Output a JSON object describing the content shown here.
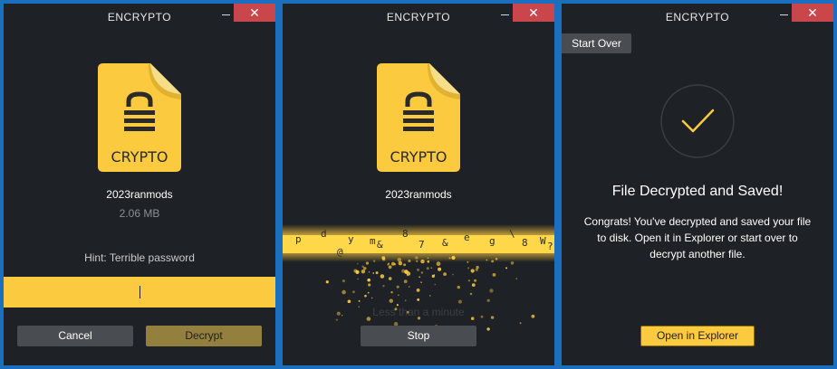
{
  "app": {
    "title": "ENCRYPTO",
    "close_glyph": "✕",
    "minimize_icon": "minimize-icon",
    "close_icon": "close-icon"
  },
  "colors": {
    "accent": "#fcca3f",
    "window_bg": "#1e2125",
    "button_gray": "#494c50",
    "close_red": "#c9464b"
  },
  "file_icon": {
    "label": "CRYPTO",
    "icon": "crypto-file-lock-icon"
  },
  "decrypt_window": {
    "file_name": "2023ranmods",
    "file_size": "2.06 MB",
    "hint": "Hint: Terrible password",
    "password_value": "",
    "cancel_label": "Cancel",
    "decrypt_label": "Decrypt"
  },
  "progress_window": {
    "file_name": "2023ranmods",
    "scramble_chars": [
      "p",
      "d",
      "y",
      "&",
      "8",
      "7",
      "&",
      "e",
      "g",
      "\\",
      "8",
      "?",
      "W",
      "m",
      "@"
    ],
    "status_text": "Less than a minute",
    "stop_label": "Stop"
  },
  "done_window": {
    "start_over_label": "Start Over",
    "check_icon": "checkmark-icon",
    "heading": "File Decrypted and Saved!",
    "message": "Congrats! You've decrypted and saved your file to disk. Open it in Explorer or start over to decrypt another file.",
    "open_explorer_label": "Open in Explorer"
  }
}
